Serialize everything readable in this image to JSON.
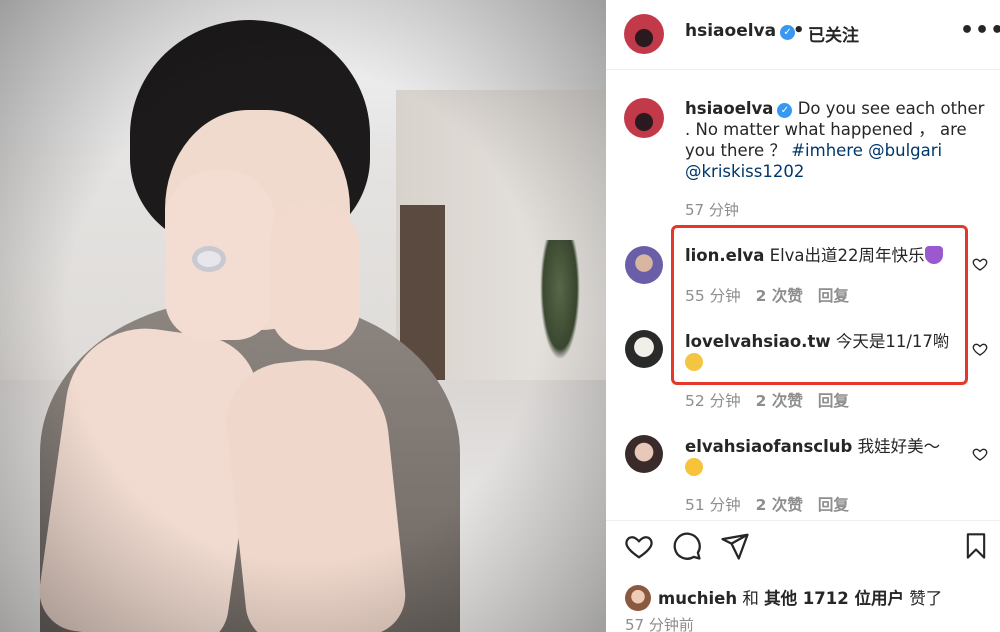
{
  "header": {
    "username": "hsiaoelva",
    "follow_status": "已关注",
    "separator": "•",
    "more": "•••"
  },
  "caption": {
    "username": "hsiaoelva",
    "text": "Do you see each other . No matter what happened ，  are you there ？",
    "hashtag": "#imhere",
    "mention1": "@bulgari",
    "mention2": "@kriskiss1202",
    "time": "57 分钟"
  },
  "comments": [
    {
      "username": "lion.elva",
      "text": "Elva出道22周年快乐",
      "emoji": "purple-heart",
      "time": "55 分钟",
      "likes": "2 次赞",
      "reply": "回复"
    },
    {
      "username": "lovelvahsiao.tw",
      "text": "今天是11/17喲",
      "emoji": "raised-hands",
      "time": "52 分钟",
      "likes": "2 次赞",
      "reply": "回复"
    },
    {
      "username": "elvahsiaofansclub",
      "text": "我娃好美～",
      "emoji": "smiling-face-with-hearts",
      "time": "51 分钟",
      "likes": "2 次赞",
      "reply": "回复"
    }
  ],
  "liked_by": {
    "user": "muchieh",
    "connector": "和",
    "others": "其他 1712 位用户",
    "suffix": "赞了"
  },
  "post_time": "57 分钟前",
  "colors": {
    "highlight_border": "#e5372a",
    "verified": "#3897f0",
    "link": "#00376b",
    "secondary_text": "#8e8e8e"
  }
}
